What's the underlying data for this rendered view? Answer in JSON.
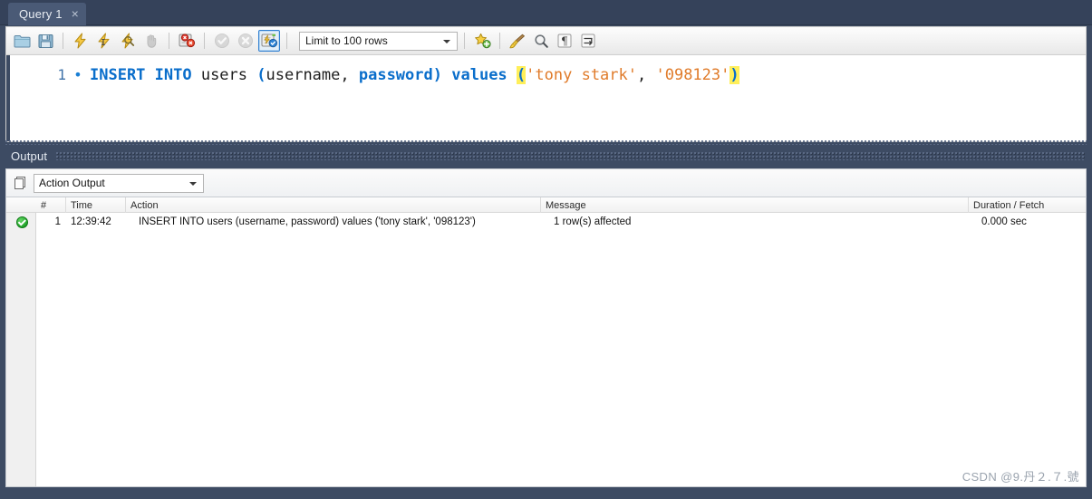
{
  "window": {
    "app": "MySQL Workbench SQL Editor"
  },
  "tab": {
    "label": "Query 1",
    "close": "×"
  },
  "toolbar": {
    "items": [
      {
        "name": "open-sql-script-icon",
        "tip": "Open a SQL script file"
      },
      {
        "name": "save-sql-script-icon",
        "tip": "Save script to file"
      },
      {
        "name": "execute-statement-icon",
        "tip": "Execute the selected portion of the script"
      },
      {
        "name": "execute-current-statement-icon",
        "tip": "Execute the statement under the keyboard cursor"
      },
      {
        "name": "explain-statement-icon",
        "tip": "Execute EXPLAIN on the statement"
      },
      {
        "name": "stop-execution-icon",
        "tip": "Stop the query being executed"
      },
      {
        "name": "toggle-stop-on-error-icon",
        "tip": "Toggle whether execution should stop on errors"
      },
      {
        "name": "commit-transaction-icon",
        "tip": "Commit the current transaction"
      },
      {
        "name": "rollback-transaction-icon",
        "tip": "Rollback the current transaction"
      },
      {
        "name": "autocommit-toggle-icon",
        "tip": "Toggle auto-commit mode"
      },
      {
        "name": "save-snippet-icon",
        "tip": "Save current statement to snippets"
      },
      {
        "name": "beautify-query-icon",
        "tip": "Beautify/reformat the SQL script"
      },
      {
        "name": "find-icon",
        "tip": "Show the Find panel"
      },
      {
        "name": "toggle-invisible-chars-icon",
        "tip": "Toggle invisible characters"
      },
      {
        "name": "toggle-wrapping-icon",
        "tip": "Toggle word wrapping"
      }
    ],
    "limit_label": "Limit to 100 rows"
  },
  "editor": {
    "line_number": "1",
    "bullet": "●",
    "tokens": [
      {
        "text": "INSERT INTO",
        "type": "kw"
      },
      {
        "text": " users ",
        "type": "plain"
      },
      {
        "text": "(username, ",
        "type": "paren-open-plain"
      },
      {
        "text": "password",
        "type": "kw"
      },
      {
        "text": ")",
        "type": "paren"
      },
      {
        "text": " ",
        "type": "plain"
      },
      {
        "text": "values",
        "type": "kw"
      },
      {
        "text": " ",
        "type": "plain"
      },
      {
        "text": "(",
        "type": "paren-hl"
      },
      {
        "text": "'tony stark'",
        "type": "str"
      },
      {
        "text": ", ",
        "type": "plain"
      },
      {
        "text": "'098123'",
        "type": "str"
      },
      {
        "text": ")",
        "type": "paren-hl"
      }
    ],
    "full_text": "INSERT INTO users (username, password) values ('tony stark', '098123')"
  },
  "output": {
    "panel_title": "Output",
    "selector_value": "Action Output",
    "columns": [
      "#",
      "Time",
      "Action",
      "Message",
      "Duration / Fetch"
    ],
    "rows": [
      {
        "status": "success",
        "num": "1",
        "time": "12:39:42",
        "action": "INSERT INTO users (username, password) values ('tony stark', '098123')",
        "message": "1 row(s) affected",
        "duration": "0.000 sec"
      }
    ]
  },
  "watermark": {
    "text": "CSDN @9.丹２.７.號"
  },
  "colors": {
    "chrome": "#3d4b63",
    "tab_active": "#4a5a76",
    "keyword": "#0a6ecb",
    "string": "#e07b2a",
    "paren_highlight": "#ffef5a",
    "success": "#23a32b"
  }
}
